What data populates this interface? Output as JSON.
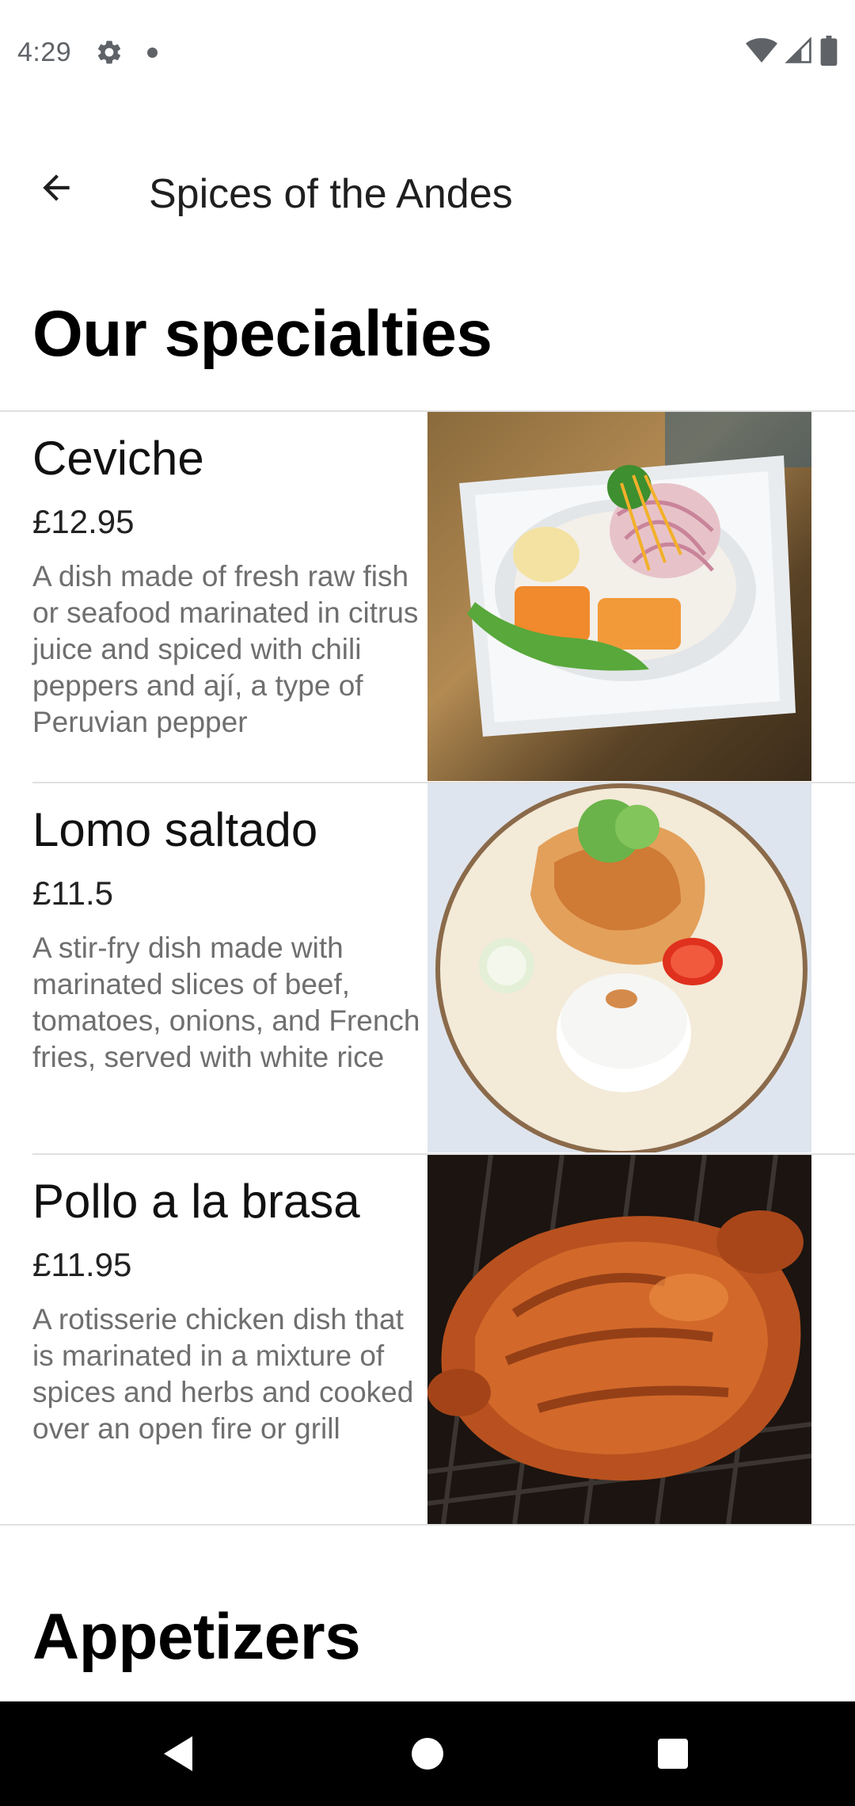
{
  "status_bar": {
    "time": "4:29",
    "icons": [
      "gear-icon",
      "notification-dot-icon",
      "wifi-icon",
      "signal-icon",
      "battery-icon"
    ]
  },
  "app_bar": {
    "title": "Spices of the Andes",
    "back_icon": "arrow-left-icon"
  },
  "sections": [
    {
      "title": "Our specialties",
      "items": [
        {
          "name": "Ceviche",
          "price": "£12.95",
          "description": "A dish made of fresh raw fish or seafood marinated in citrus juice and spiced with chili peppers and ají, a type of Peruvian pepper"
        },
        {
          "name": "Lomo saltado",
          "price": "£11.5",
          "description": "A stir-fry dish made with marinated slices of beef, tomatoes, onions, and French fries, served with white rice"
        },
        {
          "name": "Pollo a la brasa",
          "price": "£11.95",
          "description": "A rotisserie chicken dish that is marinated in a mixture of spices and herbs and cooked over an open fire or grill"
        }
      ]
    },
    {
      "title": "Appetizers"
    }
  ],
  "nav_bar": {
    "icons": [
      "back-triangle-icon",
      "home-circle-icon",
      "recents-square-icon"
    ]
  },
  "colors": {
    "background": "#ffffff",
    "title_text": "#000000",
    "description_text": "#6f6f6f",
    "divider": "#e0e0e0",
    "nav_bar": "#000000"
  }
}
